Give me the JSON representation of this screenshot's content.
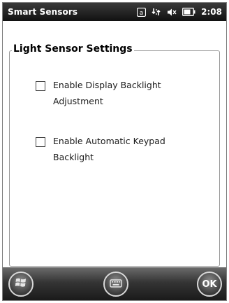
{
  "status_bar": {
    "title": "Smart Sensors",
    "time": "2:08",
    "icons": [
      "notification-icon",
      "connectivity-icon",
      "volume-muted-icon",
      "battery-icon"
    ]
  },
  "group": {
    "title": "Light Sensor Settings"
  },
  "options": [
    {
      "label": "Enable Display Backlight Adjustment",
      "checked": false
    },
    {
      "label": "Enable Automatic Keypad Backlight",
      "checked": false
    }
  ],
  "softkeys": {
    "start_icon": "windows-start-icon",
    "keyboard_icon": "keyboard-icon",
    "ok_label": "OK"
  }
}
